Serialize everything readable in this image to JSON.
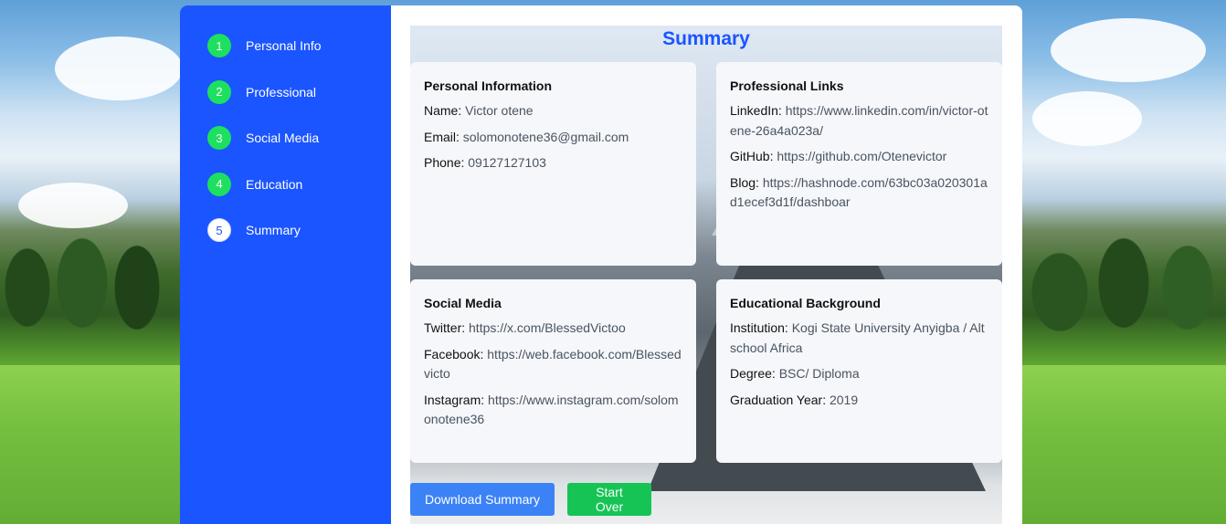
{
  "steps": [
    {
      "num": "1",
      "label": "Personal Info"
    },
    {
      "num": "2",
      "label": "Professional"
    },
    {
      "num": "3",
      "label": "Social Media"
    },
    {
      "num": "4",
      "label": "Education"
    },
    {
      "num": "5",
      "label": "Summary"
    }
  ],
  "summary": {
    "title": "Summary",
    "personal": {
      "heading": "Personal Information",
      "name_label": "Name:",
      "name": "Victor otene",
      "email_label": "Email:",
      "email": "solomonotene36@gmail.com",
      "phone_label": "Phone:",
      "phone": "09127127103"
    },
    "professional": {
      "heading": "Professional Links",
      "linkedin_label": "LinkedIn:",
      "linkedin": "https://www.linkedin.com/in/victor-otene-26a4a023a/",
      "github_label": "GitHub:",
      "github": "https://github.com/Otenevictor",
      "blog_label": "Blog:",
      "blog": "https://hashnode.com/63bc03a020301ad1ecef3d1f/dashboar"
    },
    "social": {
      "heading": "Social Media",
      "twitter_label": "Twitter:",
      "twitter": "https://x.com/BlessedVictoo",
      "facebook_label": "Facebook:",
      "facebook": "https://web.facebook.com/Blessedvicto",
      "instagram_label": "Instagram:",
      "instagram": "https://www.instagram.com/solomonotene36"
    },
    "education": {
      "heading": "Educational Background",
      "institution_label": "Institution:",
      "institution": "Kogi State University Anyigba / Altschool Africa",
      "degree_label": "Degree:",
      "degree": "BSC/ Diploma",
      "year_label": "Graduation Year:",
      "year": "2019"
    },
    "download_label": "Download Summary",
    "start_over_label": "Start Over"
  },
  "colors": {
    "sidebar": "#1a55ff",
    "step_done": "#1ee05f",
    "title": "#1a55ff",
    "download_button": "#3b82f6",
    "start_over_button": "#16c455"
  }
}
